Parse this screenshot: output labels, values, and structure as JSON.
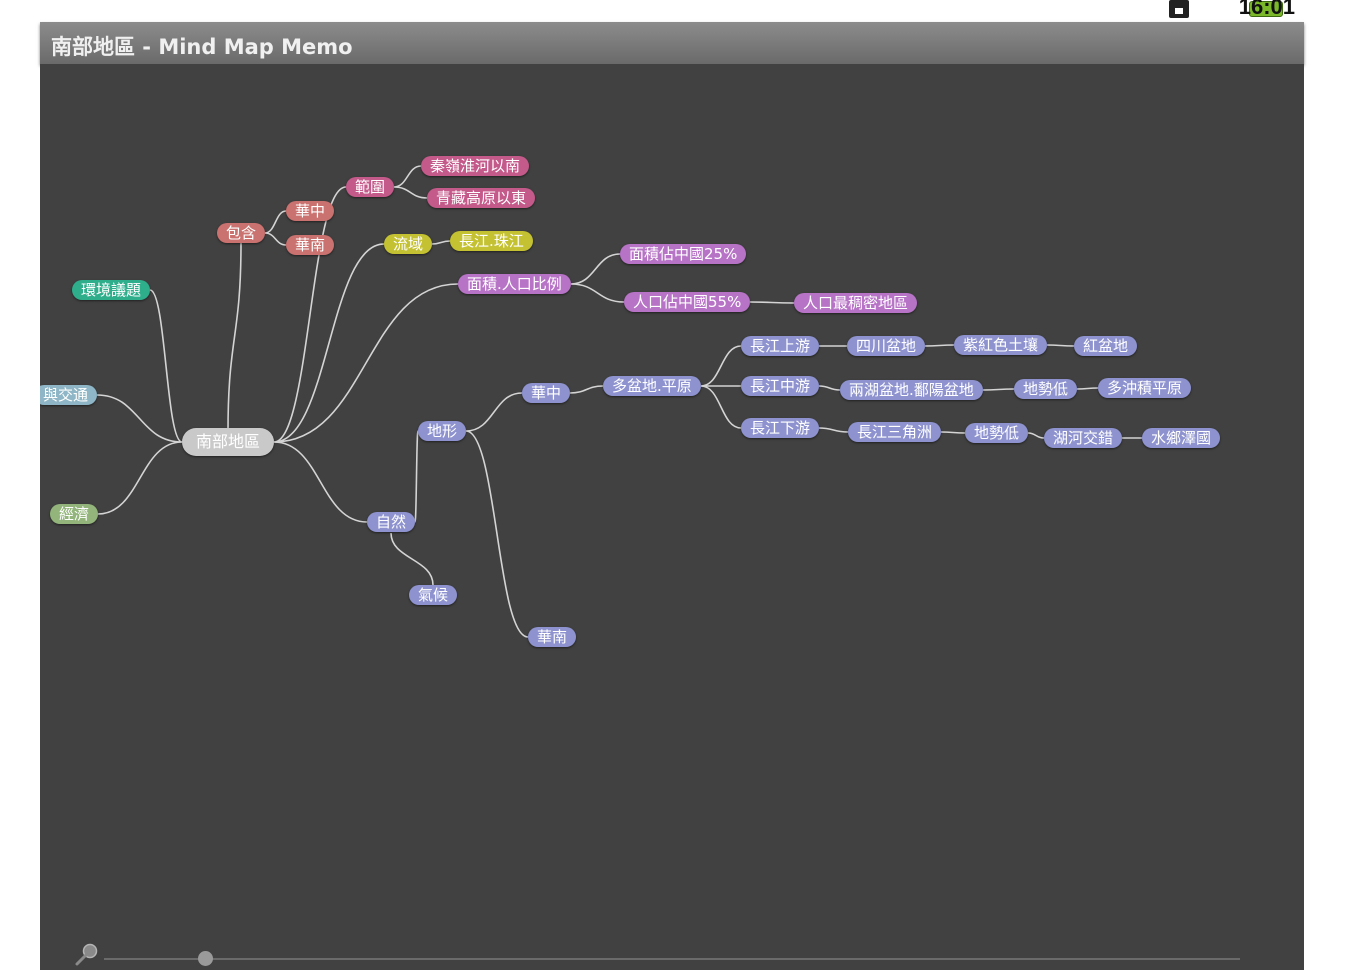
{
  "status_bar": {
    "time": "16:01",
    "icons": [
      "sim-card-icon",
      "battery-icon"
    ]
  },
  "app": {
    "title": "南部地區 - Mind Map Memo"
  },
  "colors": {
    "canvas_bg": "#414141",
    "link": "#d4d4d4",
    "root": "#c9c9c9",
    "teal": "#2fae8c",
    "light_blue": "#8eb6c6",
    "green": "#93b57c",
    "salmon": "#c9726f",
    "magenta": "#c45a8a",
    "yellow": "#c4c232",
    "purple": "#b773c6",
    "periwinkle": "#8e93cf"
  },
  "mindmap": {
    "root": "南部地區",
    "nodes": [
      {
        "id": "root",
        "label": "南部地區",
        "color": "root"
      },
      {
        "id": "env",
        "label": "環境議題",
        "color": "teal",
        "parent": "root"
      },
      {
        "id": "traffic",
        "label": "與交通",
        "color": "light_blue",
        "parent": "root"
      },
      {
        "id": "econ",
        "label": "經濟",
        "color": "green",
        "parent": "root"
      },
      {
        "id": "include",
        "label": "包含",
        "color": "salmon",
        "parent": "root"
      },
      {
        "id": "inc_hz",
        "label": "華中",
        "color": "salmon",
        "parent": "include"
      },
      {
        "id": "inc_hn",
        "label": "華南",
        "color": "salmon",
        "parent": "include"
      },
      {
        "id": "range",
        "label": "範圍",
        "color": "magenta",
        "parent": "root"
      },
      {
        "id": "range_1",
        "label": "秦嶺淮河以南",
        "color": "magenta",
        "parent": "range"
      },
      {
        "id": "range_2",
        "label": "青藏高原以東",
        "color": "magenta",
        "parent": "range"
      },
      {
        "id": "basin",
        "label": "流域",
        "color": "yellow",
        "parent": "root"
      },
      {
        "id": "basin_1",
        "label": "長江.珠江",
        "color": "yellow",
        "parent": "basin"
      },
      {
        "id": "area",
        "label": "面積.人口比例",
        "color": "purple",
        "parent": "root"
      },
      {
        "id": "area_1",
        "label": "面積佔中國25%",
        "color": "purple",
        "parent": "area"
      },
      {
        "id": "area_2",
        "label": "人口佔中國55%",
        "color": "purple",
        "parent": "area"
      },
      {
        "id": "area_3",
        "label": "人口最稠密地區",
        "color": "purple",
        "parent": "area_2"
      },
      {
        "id": "nature",
        "label": "自然",
        "color": "periwinkle",
        "parent": "root"
      },
      {
        "id": "terrain",
        "label": "地形",
        "color": "periwinkle",
        "parent": "nature"
      },
      {
        "id": "climate",
        "label": "氣候",
        "color": "periwinkle",
        "parent": "nature"
      },
      {
        "id": "t_hz",
        "label": "華中",
        "color": "periwinkle",
        "parent": "terrain"
      },
      {
        "id": "t_hn",
        "label": "華南",
        "color": "periwinkle",
        "parent": "terrain"
      },
      {
        "id": "plains",
        "label": "多盆地.平原",
        "color": "periwinkle",
        "parent": "t_hz"
      },
      {
        "id": "up",
        "label": "長江上游",
        "color": "periwinkle",
        "parent": "plains"
      },
      {
        "id": "up_1",
        "label": "四川盆地",
        "color": "periwinkle",
        "parent": "up"
      },
      {
        "id": "up_2",
        "label": "紫紅色土壤",
        "color": "periwinkle",
        "parent": "up_1"
      },
      {
        "id": "up_3",
        "label": "紅盆地",
        "color": "periwinkle",
        "parent": "up_2"
      },
      {
        "id": "mid",
        "label": "長江中游",
        "color": "periwinkle",
        "parent": "plains"
      },
      {
        "id": "mid_1",
        "label": "兩湖盆地.鄱陽盆地",
        "color": "periwinkle",
        "parent": "mid"
      },
      {
        "id": "mid_2",
        "label": "地勢低",
        "color": "periwinkle",
        "parent": "mid_1"
      },
      {
        "id": "mid_3",
        "label": "多沖積平原",
        "color": "periwinkle",
        "parent": "mid_2"
      },
      {
        "id": "low",
        "label": "長江下游",
        "color": "periwinkle",
        "parent": "plains"
      },
      {
        "id": "low_1",
        "label": "長江三角洲",
        "color": "periwinkle",
        "parent": "low"
      },
      {
        "id": "low_2",
        "label": "地勢低",
        "color": "periwinkle",
        "parent": "low_1"
      },
      {
        "id": "low_3",
        "label": "湖河交錯",
        "color": "periwinkle",
        "parent": "low_2"
      },
      {
        "id": "low_4",
        "label": "水鄉澤國",
        "color": "periwinkle",
        "parent": "low_3"
      }
    ]
  },
  "zoom": {
    "icon": "zoom-icon",
    "level": 0.09
  }
}
